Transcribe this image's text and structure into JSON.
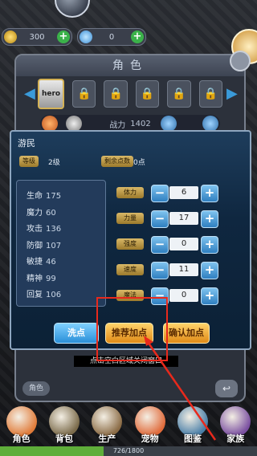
{
  "resources": {
    "gold": "300",
    "gems": "0",
    "plus": "+"
  },
  "role_panel": {
    "title": "角色",
    "hero_slot_label": "hero",
    "lock_icon": "🔒",
    "combat_label": "战力",
    "combat_power": "1402",
    "tab_label": "角色",
    "return_glyph": "↩"
  },
  "dialog": {
    "title": "游民",
    "level_label": "等级",
    "level_value": "2级",
    "points_label": "剩余点数",
    "points_value": "0点",
    "stats": [
      {
        "name": "生命",
        "value": "175"
      },
      {
        "name": "魔力",
        "value": "60"
      },
      {
        "name": "攻击",
        "value": "136"
      },
      {
        "name": "防御",
        "value": "107"
      },
      {
        "name": "敏捷",
        "value": "46"
      },
      {
        "name": "精神",
        "value": "99"
      },
      {
        "name": "回复",
        "value": "106"
      }
    ],
    "allocations": [
      {
        "label": "体力",
        "value": "6"
      },
      {
        "label": "力量",
        "value": "17"
      },
      {
        "label": "强度",
        "value": "0"
      },
      {
        "label": "速度",
        "value": "11"
      },
      {
        "label": "魔法",
        "value": "0"
      }
    ],
    "minus": "−",
    "plus": "+",
    "buttons": {
      "wash": "洗点",
      "recommend": "推荐加点",
      "confirm": "确认加点"
    }
  },
  "close_hint": "点击空白区域关闭窗口",
  "bottom_nav": [
    {
      "label": "角色",
      "color": "#e07b39"
    },
    {
      "label": "背包",
      "color": "#7a6a4a"
    },
    {
      "label": "生产",
      "color": "#8a6b45"
    },
    {
      "label": "宠物",
      "color": "#e06a3a"
    },
    {
      "label": "图鉴",
      "color": "#4a7fa8"
    },
    {
      "label": "家族",
      "color": "#7a4fa0"
    }
  ],
  "progress": {
    "text": "726/1800",
    "fraction": 0.403
  },
  "colors": {
    "annotation_red": "#e8291c"
  }
}
